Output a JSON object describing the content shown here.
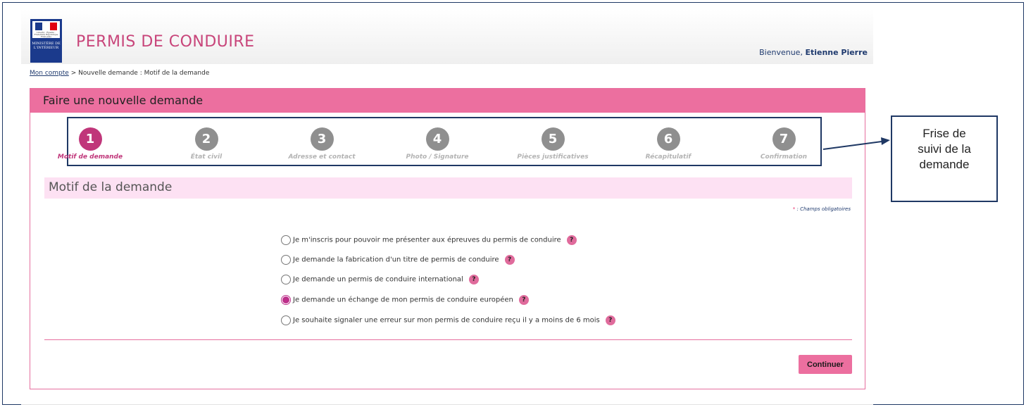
{
  "header": {
    "logo_republique": "Liberté · Égalité · Fraternité République Française",
    "logo_ministere": "MINISTÈRE DE L'INTÉRIEUR",
    "site_title": "PERMIS DE CONDUIRE",
    "welcome_prefix": "Bienvenue, ",
    "user_name": "Etienne Pierre"
  },
  "breadcrumb": {
    "home_link": "Mon compte",
    "separator": ">",
    "current": "Nouvelle demande : Motif de la demande"
  },
  "card": {
    "title": "Faire une nouvelle demande"
  },
  "steps": [
    {
      "number": "1",
      "label": "Motif de demande",
      "active": true
    },
    {
      "number": "2",
      "label": "État civil",
      "active": false
    },
    {
      "number": "3",
      "label": "Adresse et contact",
      "active": false
    },
    {
      "number": "4",
      "label": "Photo / Signature",
      "active": false
    },
    {
      "number": "5",
      "label": "Pièces justificatives",
      "active": false
    },
    {
      "number": "6",
      "label": "Récapitulatif",
      "active": false
    },
    {
      "number": "7",
      "label": "Confirmation",
      "active": false
    }
  ],
  "section": {
    "title": "Motif de la demande",
    "required_star": "*",
    "required_note": " : Champs obligatoires"
  },
  "options": [
    {
      "label": "Je m'inscris pour pouvoir me présenter aux épreuves du permis de conduire",
      "checked": false
    },
    {
      "label": "Je demande la fabrication d'un titre de permis de conduire",
      "checked": false
    },
    {
      "label": "Je demande un permis de conduire international",
      "checked": false
    },
    {
      "label": "Je demande un échange de mon permis de conduire européen",
      "checked": true
    },
    {
      "label": "Je souhaite signaler une erreur sur mon permis de conduire reçu il y a moins de 6 mois",
      "checked": false
    }
  ],
  "help_glyph": "?",
  "continue_label": "Continuer",
  "annotation": {
    "line1": "Frise de",
    "line2": "suivi de la",
    "line3": "demande"
  },
  "colors": {
    "brand_pink": "#ec6f9f",
    "active_step": "#c0367a",
    "inactive_step": "#8f8f8f",
    "section_bg": "#fde1f3",
    "annotation_border": "#1f3864"
  }
}
